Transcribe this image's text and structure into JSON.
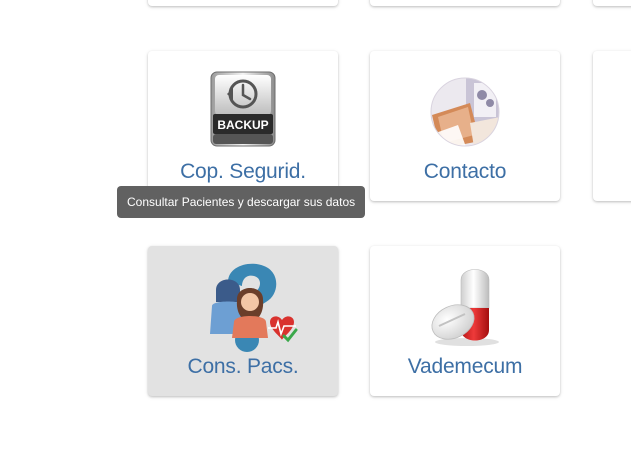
{
  "tiles": {
    "backup": {
      "label": "Cop. Segurid.",
      "icon_text": "BACKUP",
      "icon": "backup-drive-icon"
    },
    "contact": {
      "label": "Contacto",
      "icon": "contact-photo-icon"
    },
    "patients": {
      "label": "Cons. Pacs.",
      "icon": "patients-query-icon"
    },
    "vademecum": {
      "label": "Vademecum",
      "icon": "pill-capsule-icon"
    }
  },
  "tooltip": {
    "text": "Consultar Pacientes y descargar sus datos"
  },
  "colors": {
    "label": "#3d6fa5",
    "tile_bg": "#ffffff",
    "tile_hover_bg": "#e2e2e2",
    "tooltip_bg": "#616161",
    "tooltip_text": "#ffffff"
  }
}
